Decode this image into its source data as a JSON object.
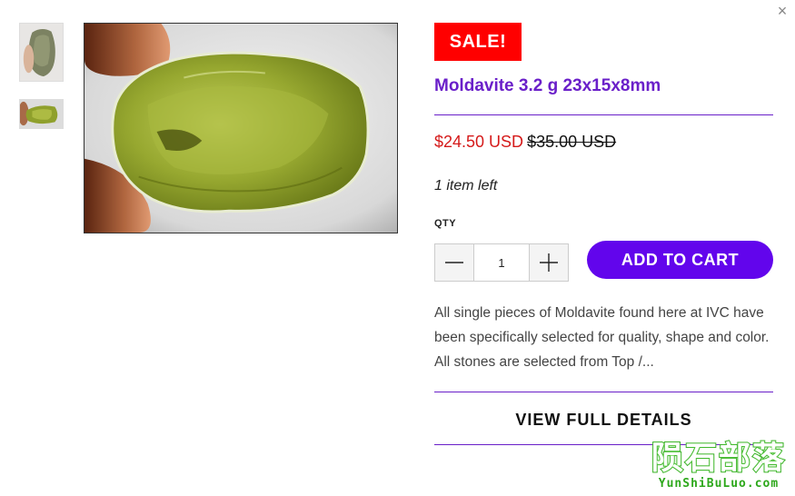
{
  "modal": {
    "close_label": "×"
  },
  "gallery": {
    "thumbnails": [
      "moldavite-photo-1",
      "moldavite-photo-2"
    ],
    "main_image": "moldavite-photo-2"
  },
  "product": {
    "badge": "SALE!",
    "title": "Moldavite 3.2 g 23x15x8mm",
    "price": "$24.50 USD",
    "compare_price": "$35.00 USD",
    "stock": "1 item left",
    "qty_label": "QTY",
    "qty_value": "1",
    "add_to_cart": "ADD TO CART",
    "description": "All single pieces of Moldavite found here at IVC have been specifically selected for quality, shape and color. All stones are selected from Top /...",
    "view_details": "VIEW FULL DETAILS"
  },
  "watermark": {
    "chinese": "陨石部落",
    "latin": "YunShiBuLuo.com"
  },
  "colors": {
    "accent": "#6a1fc9",
    "button": "#6205ec",
    "sale_badge": "#ff0000",
    "sale_price": "#d51a1a",
    "watermark": "#2ea81c"
  }
}
